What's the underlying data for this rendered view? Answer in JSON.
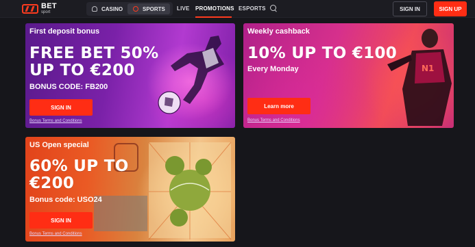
{
  "header": {
    "logo_brand": "BET",
    "logo_sub": "sport",
    "segment": {
      "casino": "CASINO",
      "sports": "SPORTS"
    },
    "nav": {
      "live": "LIVE",
      "promotions": "PROMOTIONS",
      "esports": "ESPORTS"
    },
    "sign_in": "SIGN IN",
    "sign_up": "SIGN UP"
  },
  "promos": [
    {
      "title": "First deposit bonus",
      "headline_1": "FREE BET 50%",
      "headline_2": "UP TO €200",
      "subline": "BONUS CODE: FB200",
      "cta": "SIGN IN",
      "terms": "Bonus Terms and Conditions"
    },
    {
      "title": "Weekly cashback",
      "headline_1": "10% UP TO €100",
      "subline": "Every Monday",
      "cta": "Learn more",
      "terms": "Bonus Terms and Conditions"
    },
    {
      "title": "US Open special",
      "headline_1": "60% UP TO",
      "headline_2": "€200",
      "subline": "Bonus code: USO24",
      "cta": "SIGN IN",
      "terms": "Bonus Terms and Conditions"
    }
  ],
  "icons": {
    "casino": "casino-icon",
    "sports": "sports-ball-icon",
    "search": "search-icon",
    "logo": "brand-logo"
  },
  "colors": {
    "accent": "#ff2d14",
    "background": "#16161b",
    "header": "#1c1c22"
  }
}
